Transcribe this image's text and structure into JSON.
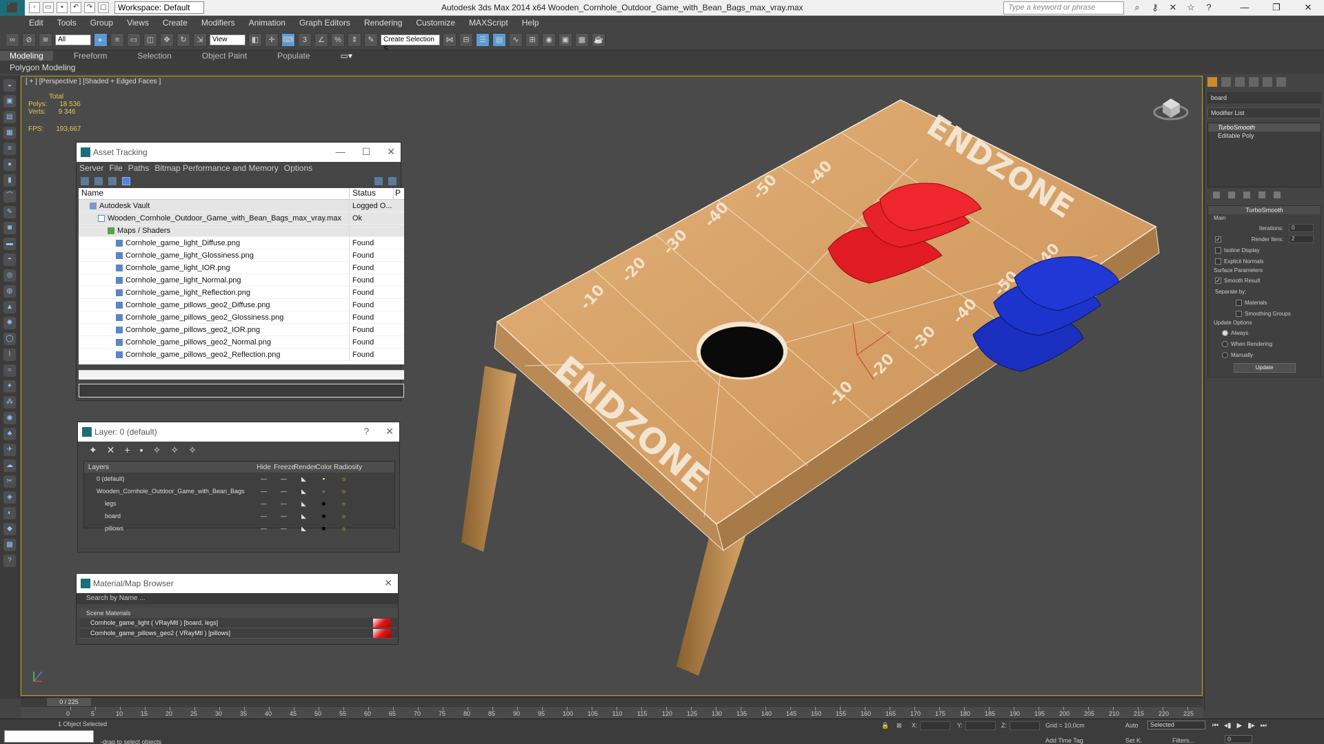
{
  "app": {
    "title": "Autodesk 3ds Max  2014 x64      Wooden_Cornhole_Outdoor_Game_with_Bean_Bags_max_vray.max",
    "workspace": "Workspace: Default",
    "search_placeholder": "Type a keyword or phrase"
  },
  "menu": [
    "Edit",
    "Tools",
    "Group",
    "Views",
    "Create",
    "Modifiers",
    "Animation",
    "Graph Editors",
    "Rendering",
    "Customize",
    "MAXScript",
    "Help"
  ],
  "toolbar": {
    "selection_filter": "All",
    "ref_coord": "View",
    "named_selection": "Create Selection S"
  },
  "ribbon": {
    "tabs": [
      "Modeling",
      "Freeform",
      "Selection",
      "Object Paint",
      "Populate"
    ],
    "panel_label": "Polygon Modeling"
  },
  "viewport": {
    "label": "[ + ] [Perspective ] [Shaded + Edged Faces ]",
    "stats": {
      "total_label": "Total",
      "polys_label": "Polys:",
      "polys": "18 536",
      "verts_label": "Verts:",
      "verts": "9 346",
      "fps_label": "FPS:",
      "fps": "193,667"
    },
    "board_text": {
      "endzone_top": "ENDZONE",
      "endzone_bottom": "ENDZONE"
    }
  },
  "asset_tracking": {
    "title": "Asset Tracking",
    "menu": [
      "Server",
      "File",
      "Paths",
      "Bitmap Performance and Memory",
      "Options"
    ],
    "col_name": "Name",
    "col_status": "Status",
    "rows": [
      {
        "name": "Autodesk Vault",
        "status": "Logged O..."
      },
      {
        "name": "Wooden_Cornhole_Outdoor_Game_with_Bean_Bags_max_vray.max",
        "status": "Ok"
      },
      {
        "name": "Maps / Shaders",
        "status": ""
      },
      {
        "name": "Cornhole_game_light_Diffuse.png",
        "status": "Found"
      },
      {
        "name": "Cornhole_game_light_Glossiness.png",
        "status": "Found"
      },
      {
        "name": "Cornhole_game_light_IOR.png",
        "status": "Found"
      },
      {
        "name": "Cornhole_game_light_Normal.png",
        "status": "Found"
      },
      {
        "name": "Cornhole_game_light_Reflection.png",
        "status": "Found"
      },
      {
        "name": "Cornhole_game_pillows_geo2_Diffuse.png",
        "status": "Found"
      },
      {
        "name": "Cornhole_game_pillows_geo2_Glossiness.png",
        "status": "Found"
      },
      {
        "name": "Cornhole_game_pillows_geo2_IOR.png",
        "status": "Found"
      },
      {
        "name": "Cornhole_game_pillows_geo2_Normal.png",
        "status": "Found"
      },
      {
        "name": "Cornhole_game_pillows_geo2_Reflection.png",
        "status": "Found"
      }
    ]
  },
  "layer": {
    "title": "Layer: 0 (default)",
    "help": "?",
    "headers": [
      "Layers",
      "Hide",
      "Freeze",
      "Render",
      "Color",
      "Radiosity"
    ],
    "rows": [
      {
        "name": "0 (default)"
      },
      {
        "name": "Wooden_Cornhole_Outdoor_Game_with_Bean_Bags"
      },
      {
        "name": "legs"
      },
      {
        "name": "board"
      },
      {
        "name": "pillows"
      }
    ]
  },
  "material_browser": {
    "title": "Material/Map Browser",
    "search": "Search by Name ...",
    "group": "Scene Materials",
    "materials": [
      "Cornhole_game_light  ( VRayMtl ) [board, legs]",
      "Cornhole_game_pillows_geo2  ( VRayMtl ) [pillows]"
    ]
  },
  "command_panel": {
    "object_name": "board",
    "modifier_list": "Modifier List",
    "stack": [
      "TurboSmooth",
      "Editable Poly"
    ],
    "turbosmooth": {
      "title": "TurboSmooth",
      "main": "Main",
      "iterations_label": "Iterations:",
      "iterations": "0",
      "render_iters_label": "Render Iters:",
      "render_iters": "2",
      "isoline": "Isoline Display",
      "explicit": "Explicit Normals",
      "surface": "Surface Parameters",
      "smooth_result": "Smooth Result",
      "separate_by": "Separate by:",
      "materials": "Materials",
      "smoothing_groups": "Smoothing Groups",
      "update_options": "Update Options",
      "always": "Always",
      "when_rendering": "When Rendering",
      "manually": "Manually",
      "update": "Update"
    }
  },
  "timeline": {
    "frame": "0 / 225",
    "ticks": [
      "0",
      "5",
      "10",
      "15",
      "20",
      "25",
      "30",
      "35",
      "40",
      "45",
      "50",
      "55",
      "60",
      "65",
      "70",
      "75",
      "80",
      "85",
      "90",
      "95",
      "100",
      "105",
      "110",
      "115",
      "120",
      "125",
      "130",
      "135",
      "140",
      "145",
      "150",
      "155",
      "160",
      "165",
      "170",
      "175",
      "180",
      "185",
      "190",
      "195",
      "200",
      "205",
      "210",
      "215",
      "220",
      "225"
    ]
  },
  "status": {
    "selected": "1 Object Selected",
    "prompt": "-drag to select objects",
    "x": "X:",
    "y": "Y:",
    "z": "Z:",
    "grid": "Grid = 10,0cm",
    "add_time_tag": "Add Time Tag",
    "auto": "Auto",
    "set_k": "Set K.",
    "selected_dd": "Selected",
    "filters": "Filters...",
    "frame_input": "0"
  },
  "colors": {
    "board_wood": "#d9a56a",
    "bag_red": "#e01b24",
    "bag_blue": "#1a2fc0",
    "viewport_border": "#c8a000",
    "stats_yellow": "#e6c84a"
  }
}
